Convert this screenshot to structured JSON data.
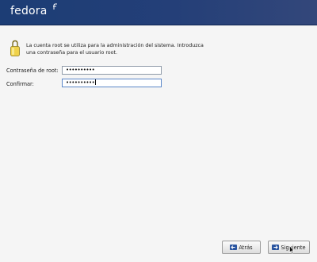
{
  "header": {
    "logo_text": "fedora",
    "background_color": "#1c3d75"
  },
  "info": {
    "icon": "lock-icon",
    "text": "La cuenta root se utiliza para la administración del sistema. Introduzca una contraseña para el usuario root."
  },
  "form": {
    "password_label": "Contraseña de root:",
    "password_value": "••••••••••",
    "confirm_label": "Confirmar:",
    "confirm_value": "••••••••••"
  },
  "buttons": {
    "back_label": "Atrás",
    "back_icon": "arrow-left-icon",
    "next_label": "Siguiente",
    "next_icon": "arrow-right-icon"
  }
}
